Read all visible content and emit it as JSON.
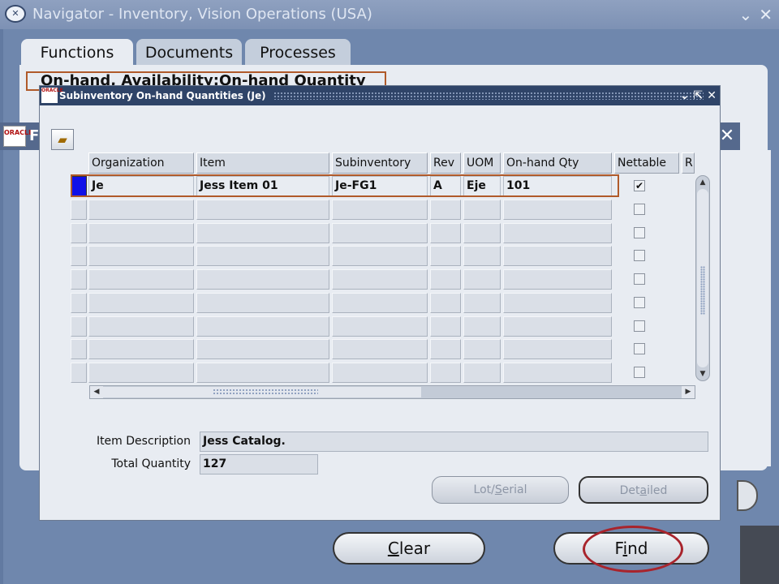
{
  "navigator": {
    "title": "Navigator - Inventory, Vision Operations (USA)",
    "tabs": [
      {
        "label": "Functions",
        "active": true
      },
      {
        "label": "Documents",
        "active": false
      },
      {
        "label": "Processes",
        "active": false
      }
    ],
    "selected_function": "On-hand, Availability:On-hand Quantity"
  },
  "background_window": {
    "logo_text": "ORACLE",
    "title_initial": "F"
  },
  "dialog": {
    "title": "Subinventory On-hand Quantities (Je)",
    "logo_text": "ORACLE",
    "columns": [
      "Organization",
      "Item",
      "Subinventory",
      "Rev",
      "UOM",
      "On-hand Qty",
      "Nettable",
      "R"
    ],
    "rows": [
      {
        "organization": "Je",
        "item": "Jess Item 01",
        "subinventory": "Je-FG1",
        "rev": "A",
        "uom": "Eje",
        "onhand_qty": "101",
        "nettable": true
      }
    ],
    "empty_row_count": 8,
    "item_description_label": "Item Description",
    "item_description": "Jess Catalog.",
    "total_quantity_label": "Total Quantity",
    "total_quantity": "127",
    "buttons": {
      "lot_serial_pre": "Lot/",
      "lot_serial_mnemonic": "S",
      "lot_serial_post": "erial",
      "detailed_pre": "Det",
      "detailed_mnemonic": "a",
      "detailed_post": "iled"
    }
  },
  "find_window": {
    "clear_mnemonic": "C",
    "clear_rest": "lear",
    "find_pre": "F",
    "find_mnemonic": "i",
    "find_post": "nd"
  },
  "colors": {
    "desktop": "#627aa1",
    "dialog_title": "#2f4468",
    "highlight": "#b05a2a",
    "find_circle": "#a8242c",
    "current_record": "#1010e8"
  }
}
